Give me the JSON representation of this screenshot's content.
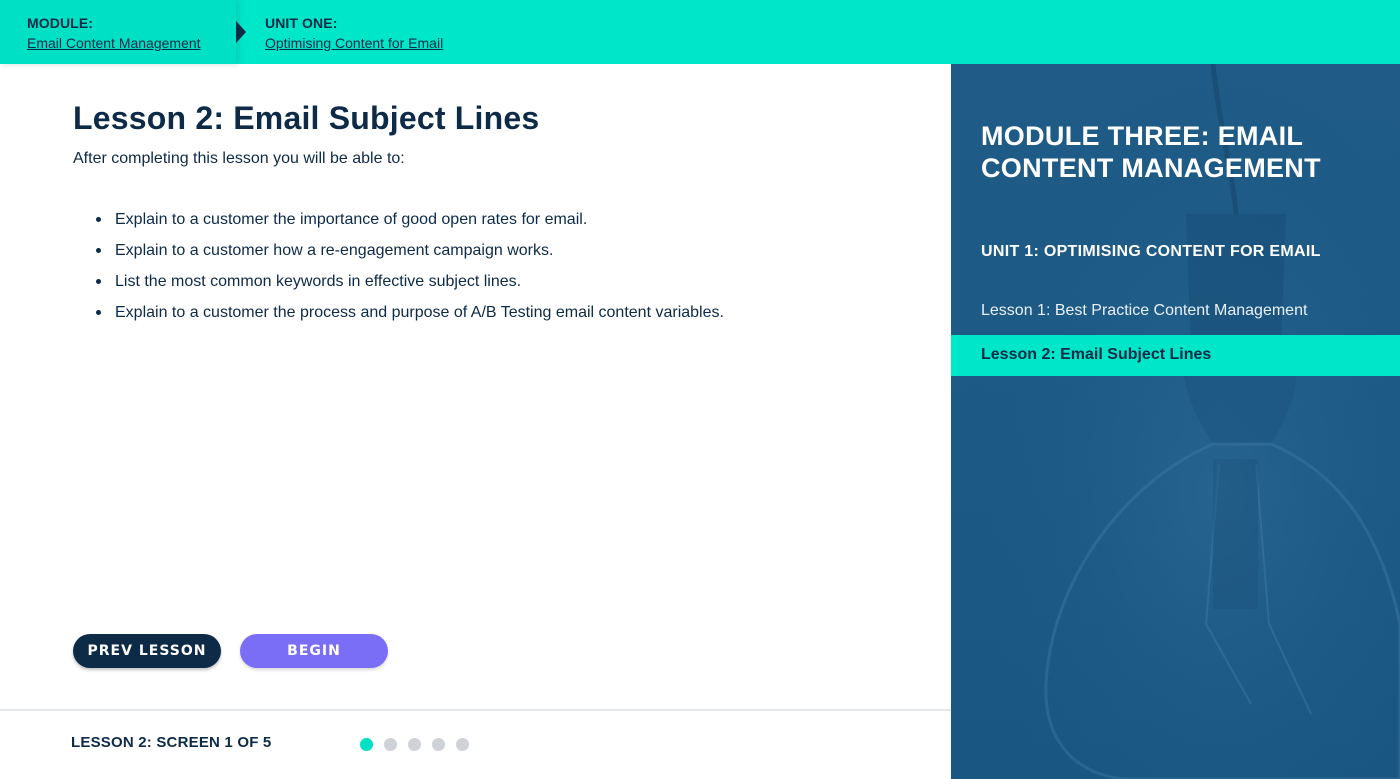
{
  "breadcrumb": {
    "module_label": "MODULE:",
    "module_link": "Email Content Management",
    "unit_label": "UNIT ONE:",
    "unit_link": "Optimising Content for Email"
  },
  "lesson": {
    "title": "Lesson 2: Email Subject Lines",
    "intro": "After completing this lesson you will be able to:",
    "objectives": [
      "Explain to a customer the importance of good open rates for email.",
      "Explain to a customer how a re-engagement campaign works.",
      "List the most common keywords in effective subject lines.",
      "Explain to a customer the process and purpose of A/B Testing email content variables."
    ]
  },
  "buttons": {
    "prev": "PREV LESSON",
    "begin": "BEGIN"
  },
  "footer": {
    "screen_label": "LESSON 2: SCREEN 1 OF 5",
    "current_screen": 1,
    "total_screens": 5
  },
  "sidebar": {
    "module_title": "MODULE THREE: EMAIL CONTENT MANAGEMENT",
    "unit_title": "UNIT 1: OPTIMISING CONTENT FOR EMAIL",
    "lessons": [
      "Lesson 1: Best Practice Content Management",
      "Lesson 2: Email Subject Lines"
    ],
    "active_lesson_index": 1
  },
  "colors": {
    "accent_teal": "#00e6c8",
    "navy": "#0d2a47",
    "begin_purple": "#7b6ef6",
    "sidebar_blue": "#1f5b86"
  },
  "icons": [
    "breadcrumb-arrow-icon",
    "bullet-icon",
    "lightbulb-background"
  ]
}
